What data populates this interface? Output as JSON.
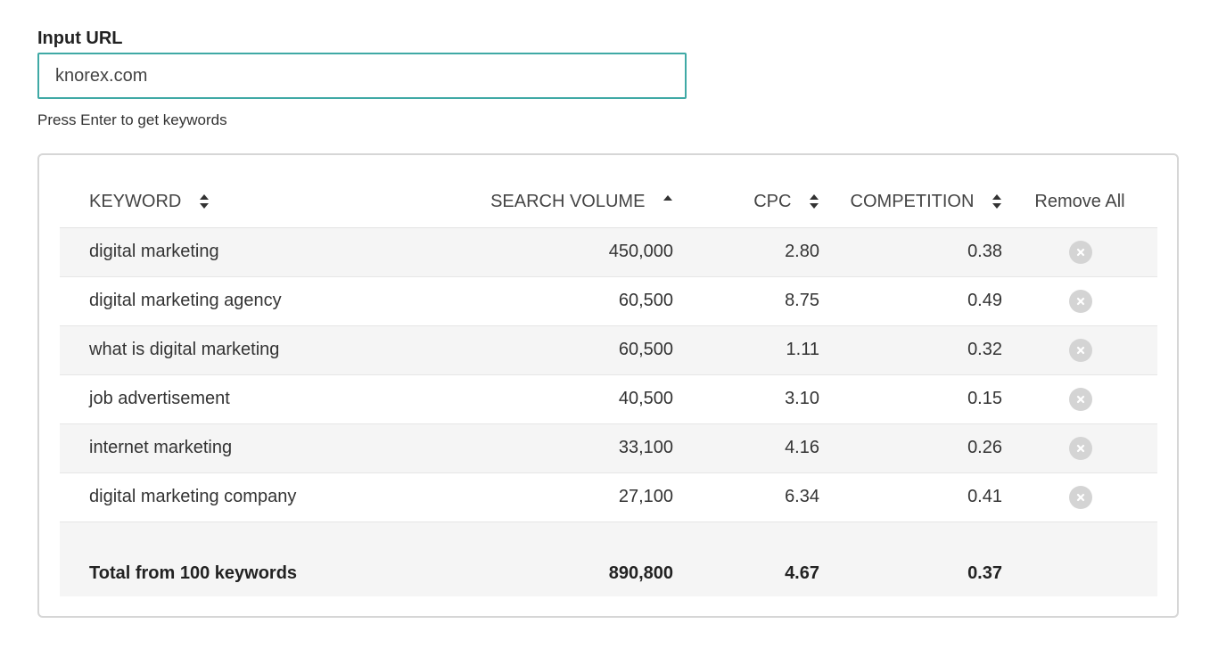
{
  "url_field": {
    "label": "Input URL",
    "value": "knorex.com",
    "hint": "Press Enter to get keywords"
  },
  "table": {
    "headers": {
      "keyword": "KEYWORD",
      "search_volume": "SEARCH VOLUME",
      "cpc": "CPC",
      "competition": "COMPETITION",
      "remove_all": "Remove All"
    },
    "sort_icons": {
      "keyword": "sort-both-icon",
      "search_volume": "sort-asc-icon",
      "cpc": "sort-both-icon",
      "competition": "sort-both-icon"
    },
    "remove_icon": "remove-circle-icon",
    "rows": [
      {
        "keyword": "digital marketing",
        "search_volume": "450,000",
        "cpc": "2.80",
        "competition": "0.38"
      },
      {
        "keyword": "digital marketing agency",
        "search_volume": "60,500",
        "cpc": "8.75",
        "competition": "0.49"
      },
      {
        "keyword": "what is digital marketing",
        "search_volume": "60,500",
        "cpc": "1.11",
        "competition": "0.32"
      },
      {
        "keyword": "job advertisement",
        "search_volume": "40,500",
        "cpc": "3.10",
        "competition": "0.15"
      },
      {
        "keyword": "internet marketing",
        "search_volume": "33,100",
        "cpc": "4.16",
        "competition": "0.26"
      },
      {
        "keyword": "digital marketing company",
        "search_volume": "27,100",
        "cpc": "6.34",
        "competition": "0.41"
      }
    ],
    "total": {
      "label": "Total from 100 keywords",
      "search_volume": "890,800",
      "cpc": "4.67",
      "competition": "0.37"
    }
  },
  "colors": {
    "input_border": "#3fa9a5",
    "row_stripe": "#f5f5f5",
    "remove_button": "#d4d4d4"
  }
}
